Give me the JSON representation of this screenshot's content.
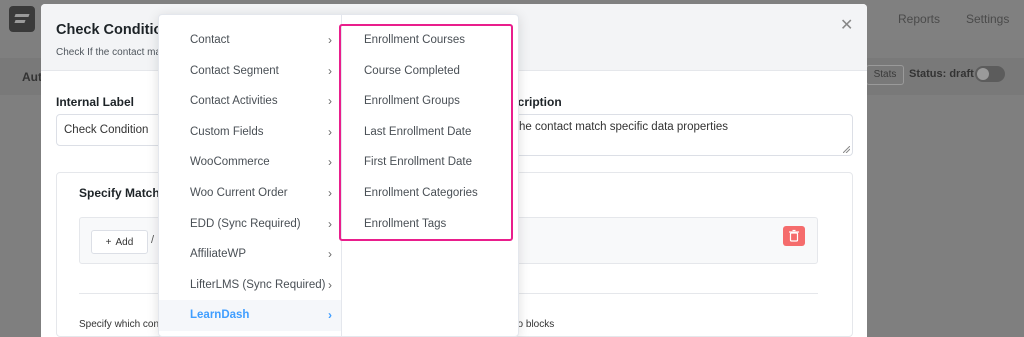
{
  "app": {
    "tabs": [
      "Reports",
      "Settings"
    ],
    "subbar": {
      "left_label": "Aut",
      "stats_label": "Stats",
      "status_label": "Status: draft"
    }
  },
  "modal": {
    "title": "Check Condition",
    "subtitle": "Check If the contact ma",
    "internal_label": {
      "label": "Internal Label",
      "value": "Check Condition"
    },
    "description": {
      "label": "scription",
      "value": "he contact match specific data properties"
    },
    "matching": {
      "title": "Specify Matchi",
      "add_button": "Add",
      "separator": "/"
    },
    "footer_text_left": "Specify which con",
    "footer_text_right": "no blocks"
  },
  "cascader": {
    "categories": [
      "Contact",
      "Contact Segment",
      "Contact Activities",
      "Custom Fields",
      "WooCommerce",
      "Woo Current Order",
      "EDD (Sync Required)",
      "AffiliateWP",
      "LifterLMS (Sync Required)",
      "LearnDash"
    ],
    "active_category": "LearnDash",
    "sub_options": [
      "Enrollment Courses",
      "Course Completed",
      "Enrollment Groups",
      "Last Enrollment Date",
      "First Enrollment Date",
      "Enrollment Categories",
      "Enrollment Tags"
    ]
  },
  "icons": {
    "close": "close-icon",
    "chevron": "chevron-right-icon",
    "plus": "plus-icon",
    "trash": "trash-icon",
    "resize": "resize-handle-icon"
  },
  "colors": {
    "accent": "#409eff",
    "highlight": "#e91e8c",
    "danger": "#f56c6c"
  }
}
